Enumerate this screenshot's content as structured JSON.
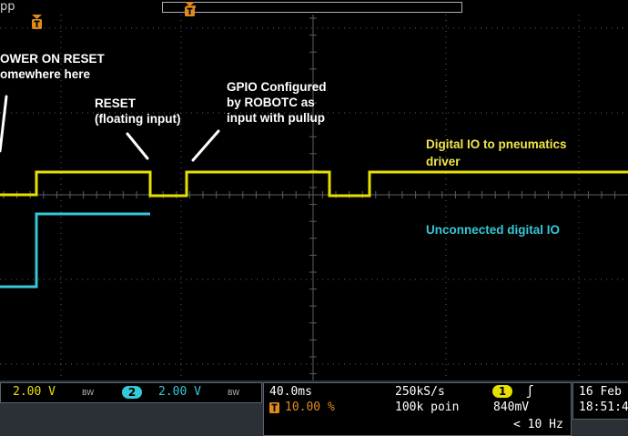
{
  "top": {
    "title_fragment": "pp"
  },
  "annotations": {
    "power_on_reset": [
      "OWER ON RESET",
      "omewhere here"
    ],
    "reset": [
      "RESET",
      "(floating input)"
    ],
    "gpio": [
      "GPIO Configured",
      "by ROBOTC as",
      "input with pullup"
    ]
  },
  "trace_labels": {
    "digital_io": [
      "Digital IO to pneumatics",
      "driver"
    ],
    "unconnected": "Unconnected digital IO"
  },
  "colors": {
    "ch1": "#e6e000",
    "ch2": "#35c8d8",
    "grid": "#5a5f63",
    "trigger": "#e08a1e"
  },
  "icons": {
    "trigger_marker": "trigger-t-icon",
    "bandwidth_limit": "bw-icon",
    "rising_edge": "rising-edge-icon"
  },
  "status": {
    "ch1_scale": "2.00 V",
    "bw_label": "BW",
    "ch2_number": "2",
    "ch2_scale": "2.00 V",
    "timebase": "40.0ms",
    "sample_rate": "250kS/s",
    "trigger_position": "10.00 %",
    "record_length": "100k poin",
    "trigger_channel": "1",
    "trigger_slope": "ʃ",
    "trigger_level": "840mV",
    "trigger_frequency": "< 10 Hz",
    "date": "16 Feb",
    "time": "18:51:4"
  }
}
